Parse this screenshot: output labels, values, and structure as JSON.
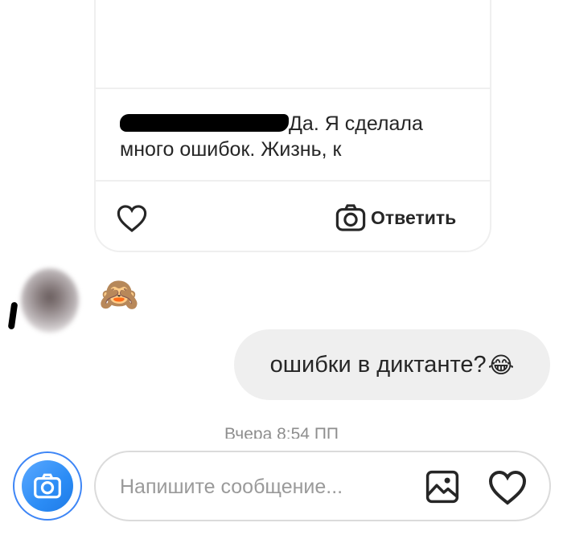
{
  "post": {
    "caption_username_redacted": "",
    "caption_text": "Да. Я сделала много ошибок. Жизнь, к",
    "reply_label": "Ответить"
  },
  "messages": [
    {
      "direction": "incoming",
      "type": "emoji",
      "text": "🙈"
    },
    {
      "direction": "outgoing",
      "type": "text",
      "text": "ошибки в диктанте?",
      "emoji": "😂"
    }
  ],
  "timestamp": "Вчера 8:54 ПП",
  "composer": {
    "placeholder": "Напишите сообщение..."
  },
  "icons": {
    "like": "heart-outline-icon",
    "camera": "camera-icon",
    "gallery": "image-icon",
    "composer_heart": "heart-outline-icon"
  },
  "colors": {
    "accent": "#3e86f6",
    "bubble_outgoing": "#efefef",
    "border": "#dbdbdb",
    "timestamp": "#8e8e8e"
  }
}
